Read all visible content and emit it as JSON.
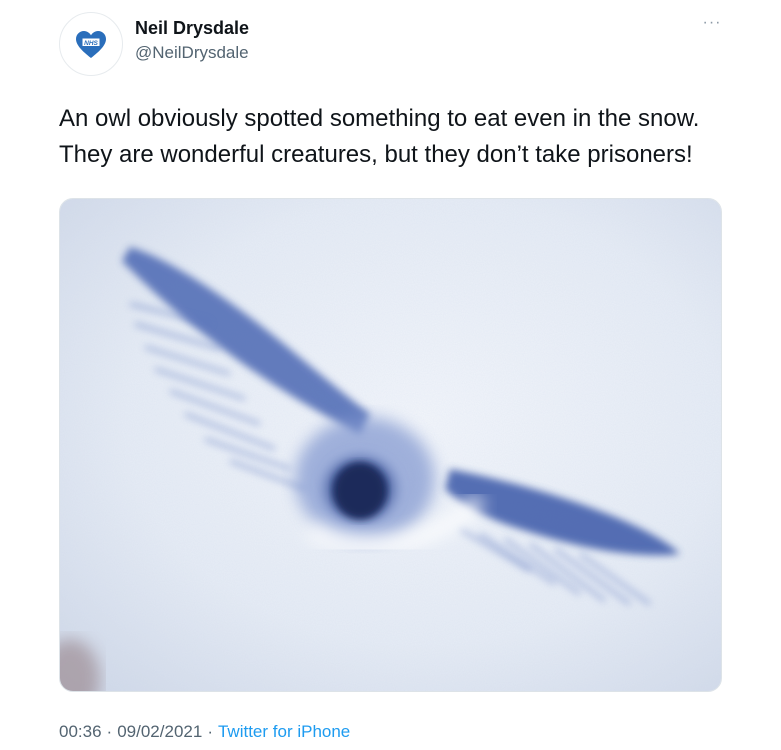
{
  "author": {
    "display_name": "Neil Drysdale",
    "handle": "@NeilDrysdale",
    "avatar_badge_text": "NHS"
  },
  "more_menu_label": "···",
  "tweet": {
    "lines": [
      "An owl obviously spotted something to eat even in the snow.",
      "They are wonderful creatures, but they don’t take prisoners!"
    ]
  },
  "meta": {
    "time": "00:36",
    "separator": "·",
    "date": "09/02/2021",
    "source": "Twitter for iPhone"
  },
  "colors": {
    "brand_blue": "#1d9bf0",
    "nhs_blue": "#2a6ebb",
    "snow_shadow": "#3b58a8"
  },
  "icons": {
    "avatar": "nhs-heart-icon",
    "more": "more-dots-icon"
  }
}
